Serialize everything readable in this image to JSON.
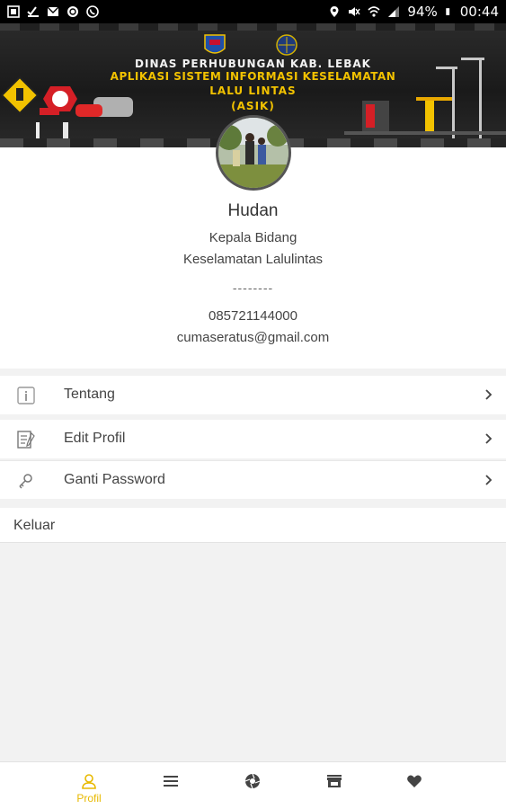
{
  "status_bar": {
    "battery": "94%",
    "time": "00:44"
  },
  "banner": {
    "line1": "DINAS PERHUBUNGAN KAB. LEBAK",
    "line2": "APLIKASI SISTEM INFORMASI KESELAMATAN",
    "line3": "LALU LINTAS",
    "line4": "(ASIK)"
  },
  "profile": {
    "name": "Hudan",
    "role_line1": "Kepala Bidang",
    "role_line2": "Keselamatan Lalulintas",
    "separator": "--------",
    "phone": "085721144000",
    "email": "cumaseratus@gmail.com"
  },
  "menu": {
    "tentang": "Tentang",
    "edit_profil": "Edit Profil",
    "ganti_password": "Ganti Password",
    "keluar": "Keluar"
  },
  "bottom_nav": {
    "active_label": "Profil",
    "items": [
      "profile-icon",
      "menu-icon",
      "shutter-icon",
      "store-icon",
      "heart-icon"
    ]
  },
  "colors": {
    "accent": "#e8b900",
    "banner_text": "#f2c200"
  }
}
